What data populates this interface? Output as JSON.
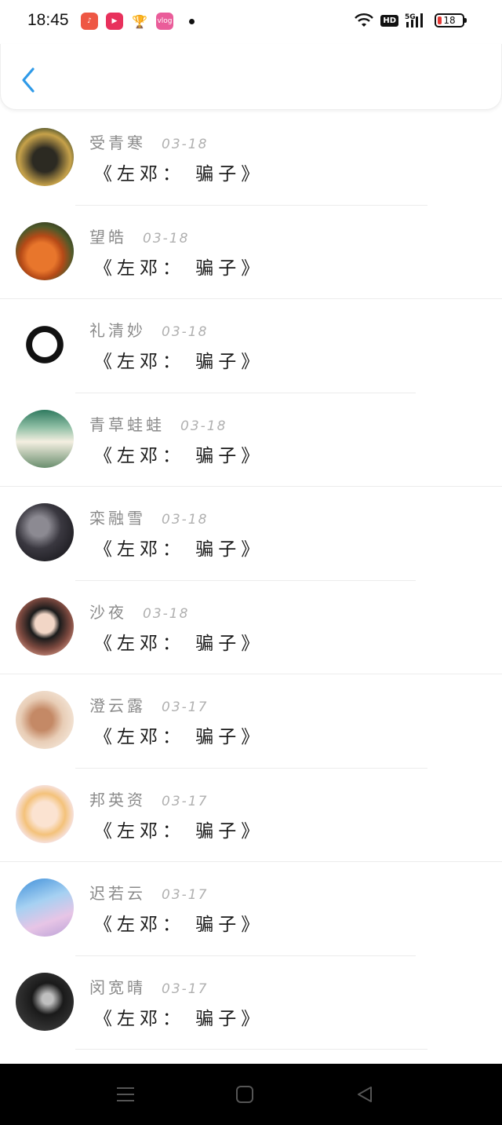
{
  "status_bar": {
    "time": "18:45",
    "battery": "18",
    "battery_level_percent": 18,
    "network": "5G",
    "hd_label": "HD",
    "app_icons": [
      "music-app-icon",
      "video-app-icon",
      "trophy-app-icon",
      "vlog-app-icon"
    ]
  },
  "header": {
    "back_icon": "chevron-left-icon",
    "accent_color": "#2f9ae8"
  },
  "items": [
    {
      "name": "受青寒",
      "date": "03-18",
      "message": "《左邓： 骗子》"
    },
    {
      "name": "望皓",
      "date": "03-18",
      "message": "《左邓： 骗子》"
    },
    {
      "name": "礼清妙",
      "date": "03-18",
      "message": "《左邓： 骗子》"
    },
    {
      "name": "青草蛙蛙",
      "date": "03-18",
      "message": "《左邓： 骗子》"
    },
    {
      "name": "栾融雪",
      "date": "03-18",
      "message": "《左邓： 骗子》"
    },
    {
      "name": "沙夜",
      "date": "03-18",
      "message": "《左邓： 骗子》"
    },
    {
      "name": "澄云露",
      "date": "03-17",
      "message": "《左邓： 骗子》"
    },
    {
      "name": "邦英资",
      "date": "03-17",
      "message": "《左邓： 骗子》"
    },
    {
      "name": "迟若云",
      "date": "03-17",
      "message": "《左邓： 骗子》"
    },
    {
      "name": "闵宽晴",
      "date": "03-17",
      "message": "《左邓： 骗子》"
    }
  ],
  "nav_bar": {
    "icons": [
      "menu-icon",
      "home-icon",
      "back-triangle-icon"
    ]
  }
}
